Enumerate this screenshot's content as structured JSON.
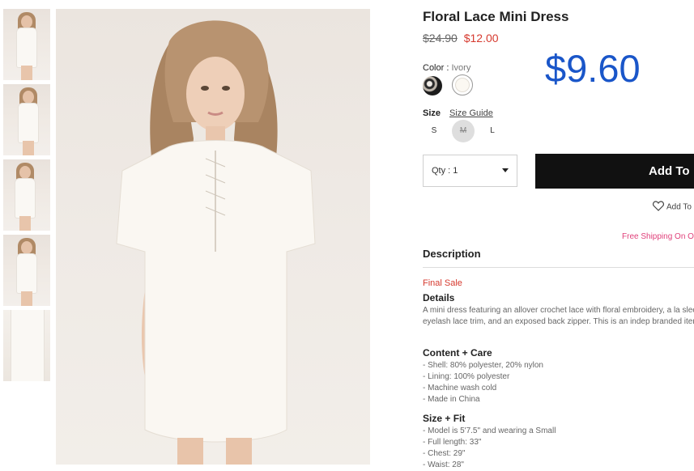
{
  "product": {
    "title": "Floral Lace Mini Dress",
    "original_price": "$24.90",
    "sale_price": "$12.00",
    "highlight_price": "$9.60"
  },
  "color": {
    "label": "Color",
    "separator": ":",
    "selected": "Ivory",
    "swatches": [
      {
        "name": "floral-swatch",
        "color": "#1c1c1c"
      },
      {
        "name": "ivory-swatch",
        "color": "#fbf8f2"
      }
    ]
  },
  "size": {
    "label": "Size",
    "guide_link": "Size Guide",
    "options": [
      "S",
      "M",
      "L"
    ]
  },
  "purchase": {
    "qty_label": "Qty : 1",
    "add_button": "Add To",
    "wishlist": "Add To",
    "free_shipping": "Free Shipping On O"
  },
  "description": {
    "heading": "Description",
    "final_sale": "Final Sale",
    "details_heading": "Details",
    "details_text": "A mini dress featuring an allover crochet lace with floral embroidery, a la sleeves, eyelash lace trim, and an exposed back zipper. This is an indep branded item.",
    "content_heading": "Content + Care",
    "content_items": [
      "- Shell: 80% polyester, 20% nylon",
      "- Lining: 100% polyester",
      "- Machine wash cold",
      "- Made in China"
    ],
    "size_fit_heading": "Size + Fit",
    "size_fit_items": [
      "- Model is 5'7.5\" and wearing a Small",
      "- Full length: 33\"",
      "- Chest: 29\"",
      "- Waist: 28\""
    ]
  },
  "colors": {
    "sale_red": "#d63a2f",
    "highlight_blue": "#1a56c9",
    "button_black": "#111111",
    "shipping_pink": "#e0407a"
  }
}
